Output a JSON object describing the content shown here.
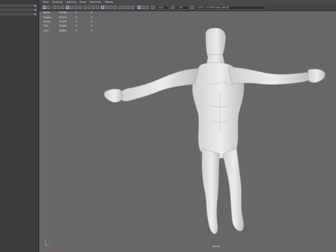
{
  "menu": [
    "View",
    "Shading",
    "Lighting",
    "Show",
    "Renderer",
    "Panels"
  ],
  "hud": {
    "rows": [
      {
        "label": "Verts:",
        "total": "14489",
        "sel": "0",
        "comp": "0"
      },
      {
        "label": "Edges:",
        "total": "30018",
        "sel": "0",
        "comp": "0"
      },
      {
        "label": "Faces:",
        "total": "15470",
        "sel": "0",
        "comp": "0"
      },
      {
        "label": "Tris:",
        "total": "29000",
        "sel": "0",
        "comp": "0"
      },
      {
        "label": "UVs:",
        "total": "16880",
        "sel": "0",
        "comp": "0"
      }
    ]
  },
  "toolbar": {
    "near_clip": "0.00",
    "far_clip": "1.00",
    "color_space": "ACES 1.0 SDR-video (sRGB)"
  },
  "camera_label": "persp"
}
